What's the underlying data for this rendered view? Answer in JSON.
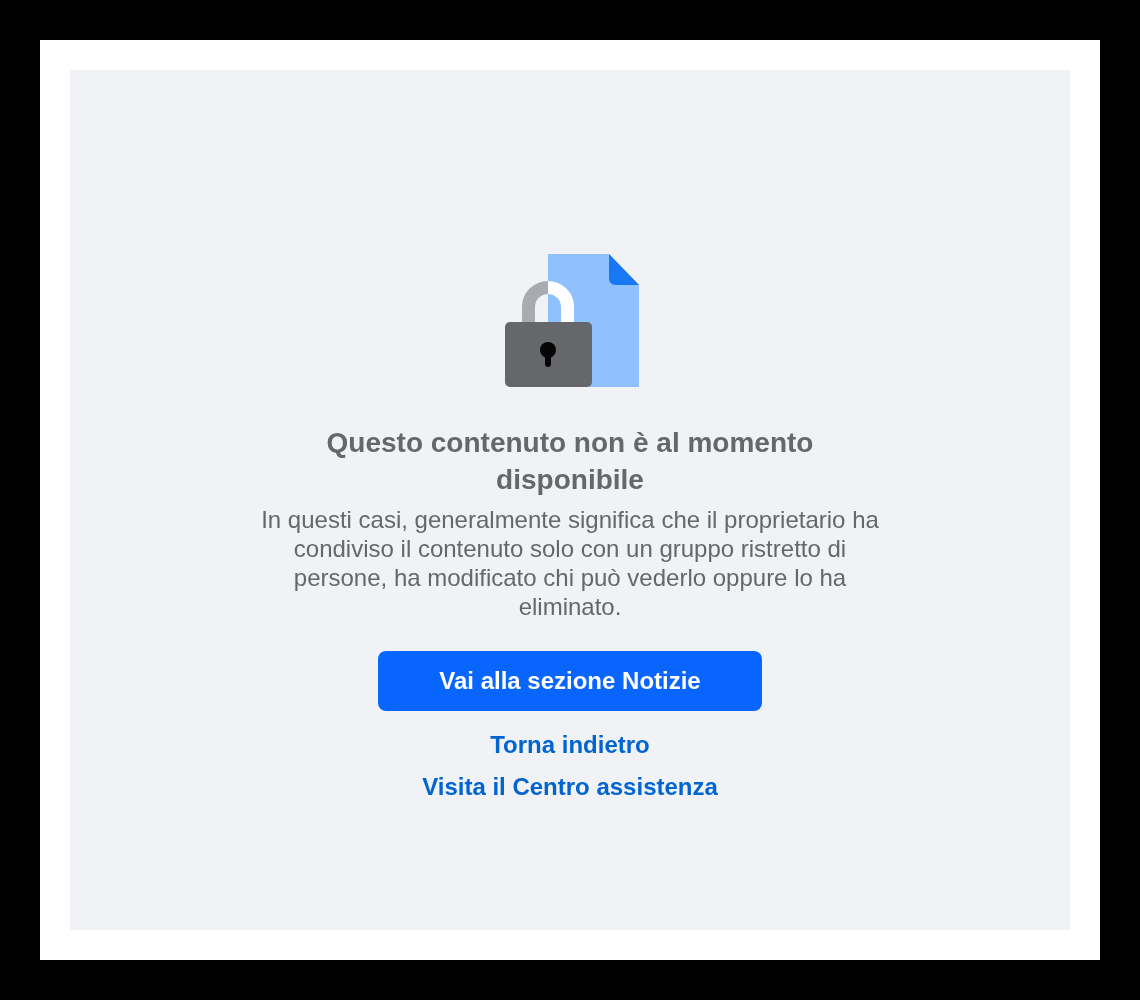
{
  "title": "Questo contenuto non è al momento disponibile",
  "message": "In questi casi, generalmente significa che il proprietario ha condiviso il contenuto solo con un gruppo ristretto di persone, ha modificato chi può vederlo oppure lo ha eliminato.",
  "primary_button": "Vai alla sezione Notizie",
  "links": [
    "Torna indietro",
    "Visita il Centro assistenza"
  ]
}
